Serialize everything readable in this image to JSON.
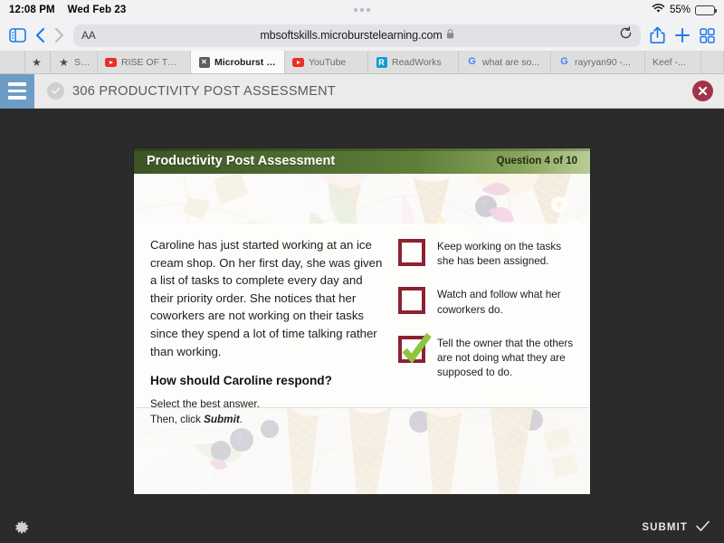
{
  "statusbar": {
    "time": "12:08 PM",
    "date": "Wed Feb 23",
    "battery_percent": "55%",
    "wifi_icon": "wifi-icon",
    "battery_icon": "battery-icon"
  },
  "toolbar": {
    "sidebar_icon": "sidebar-icon",
    "back_icon": "chevron-left-icon",
    "forward_icon": "chevron-right-icon",
    "text_size_label": "AA",
    "url": "mbsoftskills.microburstelearning.com",
    "lock_icon": "lock-icon",
    "reload_icon": "reload-icon",
    "share_icon": "share-icon",
    "new_tab_icon": "plus-icon",
    "tabs_overview_icon": "tab-overview-icon"
  },
  "tabs": [
    {
      "favicon": "star-icon",
      "label": ""
    },
    {
      "favicon": "star-icon",
      "label": "Star"
    },
    {
      "favicon": "youtube-icon",
      "label": "RISE OF THE..."
    },
    {
      "favicon": "microburst-icon",
      "label": "Microburst L...",
      "active": true
    },
    {
      "favicon": "youtube-icon",
      "label": "YouTube"
    },
    {
      "favicon": "readworks-icon",
      "label": "ReadWorks"
    },
    {
      "favicon": "google-icon",
      "label": "what are so..."
    },
    {
      "favicon": "google-icon",
      "label": "rayryan90 -..."
    },
    {
      "favicon": "none",
      "label": "Keef -..."
    }
  ],
  "app_header": {
    "menu_icon": "hamburger-menu-icon",
    "status_icon": "check-circle-icon",
    "title": "306 PRODUCTIVITY POST ASSESSMENT",
    "close_icon": "close-circle-icon"
  },
  "slide": {
    "title": "Productivity Post Assessment",
    "question_counter": "Question 4 of 10",
    "question_body": "Caroline has just started working at an ice cream shop. On her first day, she was given a list of tasks to complete every day and their priority order. She notices that her coworkers are not working on their tasks since they spend a lot of time talking rather than working.",
    "question_prompt": "How should Caroline respond?",
    "instruction_line1": "Select the best answer.",
    "instruction_line2_pre": "Then, click ",
    "instruction_line2_bold": "Submit",
    "instruction_line2_post": ".",
    "choices": [
      {
        "text": "Keep working on the tasks she has been assigned.",
        "selected": false
      },
      {
        "text": "Watch and follow what her coworkers do.",
        "selected": false
      },
      {
        "text": "Tell the owner that the others are not doing what they are supposed to do.",
        "selected": true
      }
    ]
  },
  "bottombar": {
    "settings_icon": "gear-icon",
    "submit_label": "SUBMIT",
    "submit_icon": "checkmark-icon"
  },
  "colors": {
    "accent_blue": "#1b7aea",
    "header_green": "#4e6b2f",
    "checkbox_maroon": "#8c2230",
    "check_green": "#8ec63f",
    "close_red": "#a03448",
    "dark_bg": "#2b2b2b"
  }
}
